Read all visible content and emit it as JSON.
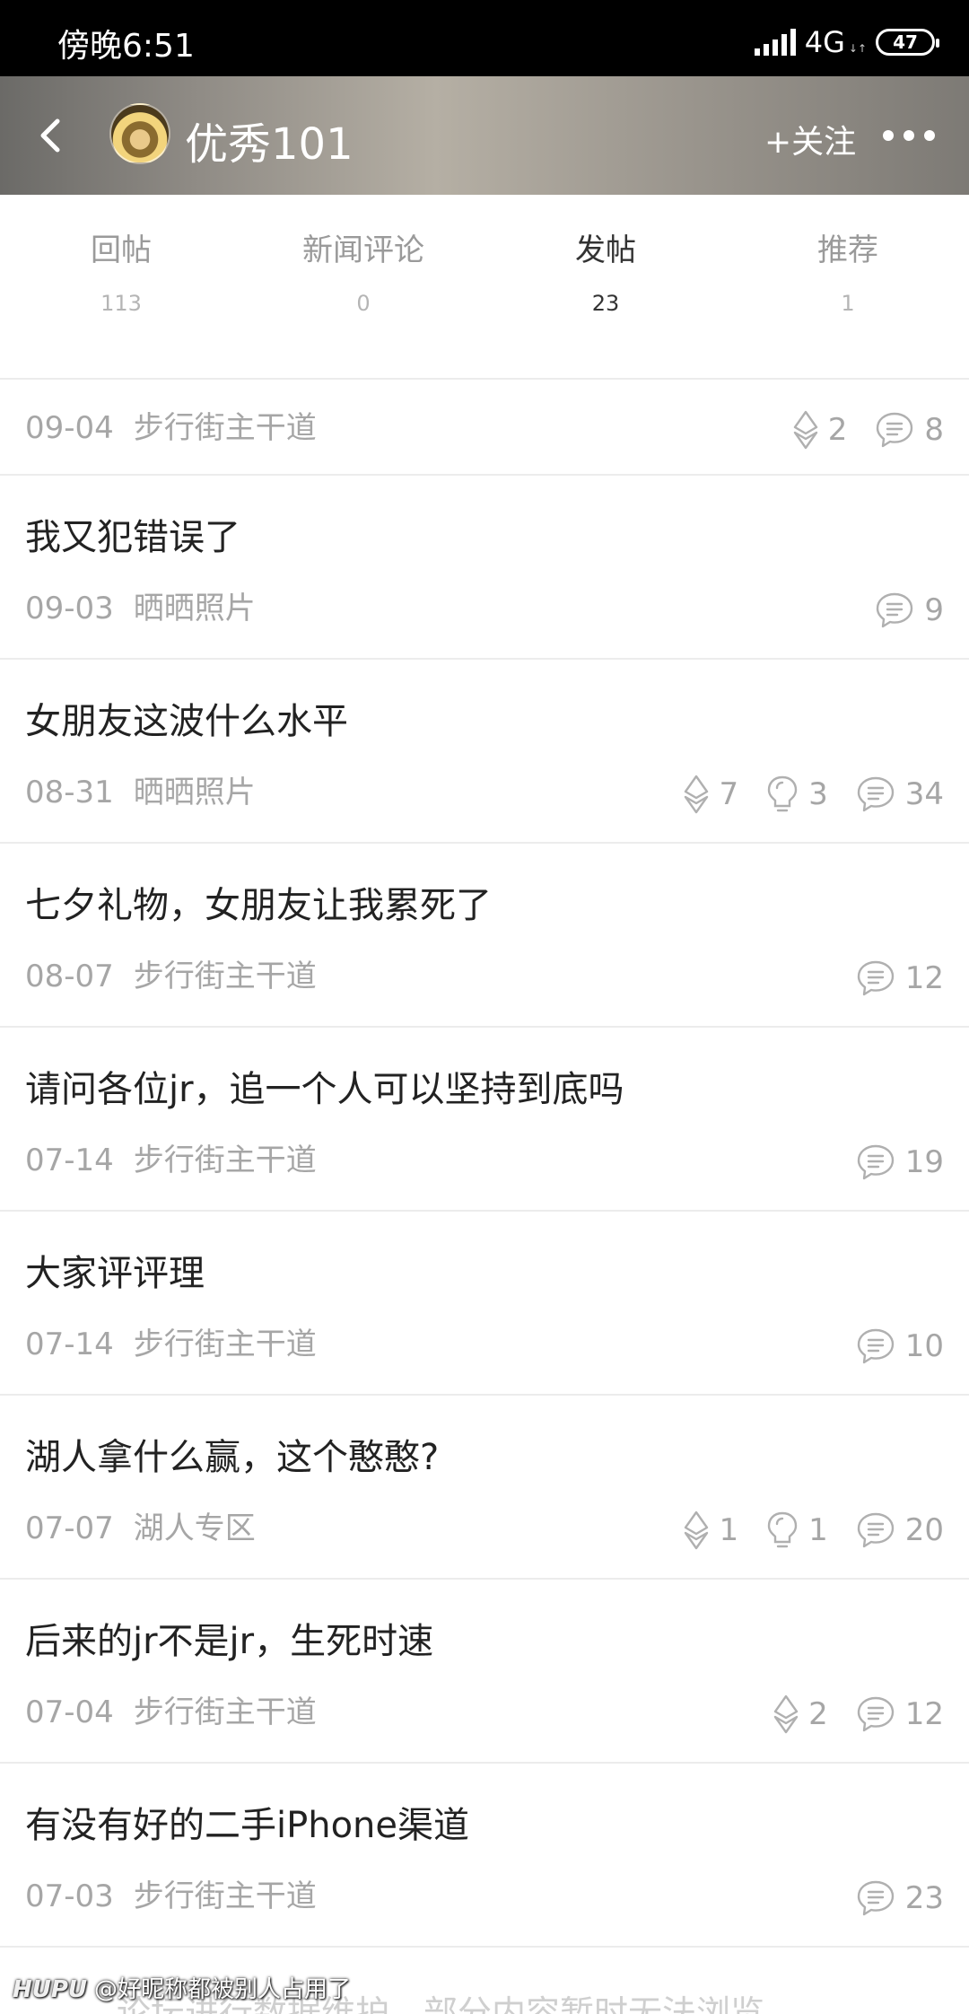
{
  "status_bar": {
    "time": "傍晚6:51",
    "network": "4G",
    "battery": "47"
  },
  "header": {
    "username": "优秀101",
    "follow_label": "+关注"
  },
  "tabs": [
    {
      "label": "回帖",
      "count": "113"
    },
    {
      "label": "新闻评论",
      "count": "0"
    },
    {
      "label": "发帖",
      "count": "23"
    },
    {
      "label": "推荐",
      "count": "1"
    }
  ],
  "posts": [
    {
      "title": "",
      "date": "09-04",
      "board": "步行街主干道",
      "lights": "2",
      "recs": "",
      "replies": "8"
    },
    {
      "title": "我又犯错误了",
      "date": "09-03",
      "board": "晒晒照片",
      "lights": "",
      "recs": "",
      "replies": "9"
    },
    {
      "title": "女朋友这波什么水平",
      "date": "08-31",
      "board": "晒晒照片",
      "lights": "7",
      "recs": "3",
      "replies": "34"
    },
    {
      "title": "七夕礼物，女朋友让我累死了",
      "date": "08-07",
      "board": "步行街主干道",
      "lights": "",
      "recs": "",
      "replies": "12"
    },
    {
      "title": "请问各位jr，追一个人可以坚持到底吗",
      "date": "07-14",
      "board": "步行街主干道",
      "lights": "",
      "recs": "",
      "replies": "19"
    },
    {
      "title": "大家评评理",
      "date": "07-14",
      "board": "步行街主干道",
      "lights": "",
      "recs": "",
      "replies": "10"
    },
    {
      "title": "湖人拿什么赢，这个憨憨?",
      "date": "07-07",
      "board": "湖人专区",
      "lights": "1",
      "recs": "1",
      "replies": "20"
    },
    {
      "title": "后来的jr不是jr，生死时速",
      "date": "07-04",
      "board": "步行街主干道",
      "lights": "2",
      "recs": "",
      "replies": "12"
    },
    {
      "title": "有没有好的二手iPhone渠道",
      "date": "07-03",
      "board": "步行街主干道",
      "lights": "",
      "recs": "",
      "replies": "23"
    }
  ],
  "watermark": {
    "brand": "HUPU",
    "text": "@好昵称都被别人占用了"
  },
  "notice": "论坛进行数据维护，部分内容暂时无法浏览"
}
